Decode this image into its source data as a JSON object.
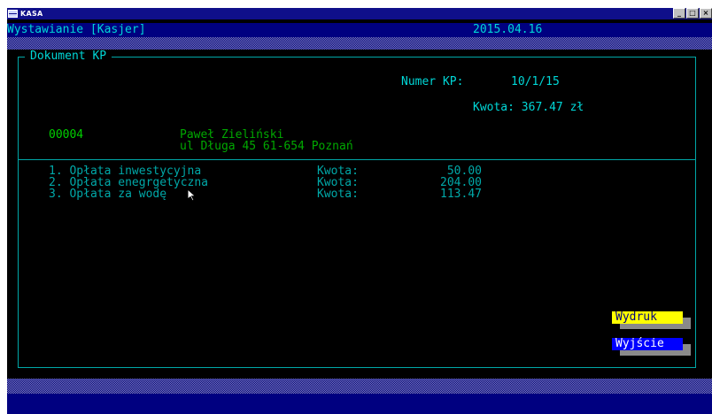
{
  "window": {
    "title": "KASA",
    "controls": [
      "_",
      "□",
      "×"
    ]
  },
  "header": {
    "title": "Wystawianie [Kasjer]",
    "date": "2015.04.16"
  },
  "document": {
    "frame_title": "Dokument KP",
    "number_label": "Numer KP:",
    "number_value": "10/1/15",
    "amount_text": "Kwota: 367.47 zł"
  },
  "customer": {
    "id": "00004",
    "name": "Paweł Zieliński",
    "address": "ul Długa 45 61-654 Poznań"
  },
  "items": [
    {
      "label": "1. Opłata inwestycyjna",
      "amount_label": "Kwota:",
      "amount": "50.00"
    },
    {
      "label": "2. Opłata enegrgetyczna",
      "amount_label": "Kwota:",
      "amount": "204.00"
    },
    {
      "label": "3. Opłata za wodę",
      "amount_label": "Kwota:",
      "amount": "113.47"
    }
  ],
  "buttons": {
    "print": "Wydruk",
    "exit": "Wyjście"
  }
}
